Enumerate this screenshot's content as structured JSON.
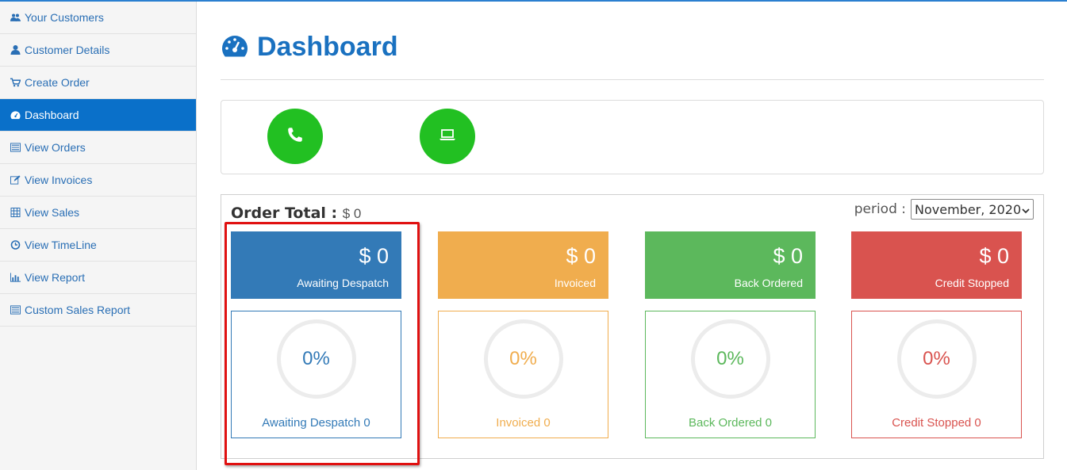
{
  "sidebar": {
    "items": [
      {
        "label": "Your Customers",
        "icon": "users-icon"
      },
      {
        "label": "Customer Details",
        "icon": "user-icon"
      },
      {
        "label": "Create Order",
        "icon": "cart-icon"
      },
      {
        "label": "Dashboard",
        "icon": "dashboard-icon",
        "active": true
      },
      {
        "label": "View Orders",
        "icon": "list-icon"
      },
      {
        "label": "View Invoices",
        "icon": "edit-icon"
      },
      {
        "label": "View Sales",
        "icon": "calculator-icon"
      },
      {
        "label": "View TimeLine",
        "icon": "clock-icon"
      },
      {
        "label": "View Report",
        "icon": "bar-chart-icon"
      },
      {
        "label": "Custom Sales Report",
        "icon": "list-icon"
      }
    ]
  },
  "header": {
    "title": "Dashboard",
    "icon": "dashboard-icon"
  },
  "contact": {
    "buttons": [
      {
        "icon": "phone-icon"
      },
      {
        "icon": "laptop-icon"
      }
    ]
  },
  "order": {
    "total_label": "Order Total :",
    "total_value": "$ 0",
    "period_label": "period :",
    "period_value": "November, 2020",
    "stats": [
      {
        "amount": "$ 0",
        "label": "Awaiting Despatch",
        "percent": "0%",
        "footer": "Awaiting Despatch 0",
        "color": "#337ab7"
      },
      {
        "amount": "$ 0",
        "label": "Invoiced",
        "percent": "0%",
        "footer": "Invoiced 0",
        "color": "#f0ad4e"
      },
      {
        "amount": "$ 0",
        "label": "Back Ordered",
        "percent": "0%",
        "footer": "Back Ordered 0",
        "color": "#5cb85c"
      },
      {
        "amount": "$ 0",
        "label": "Credit Stopped",
        "percent": "0%",
        "footer": "Credit Stopped 0",
        "color": "#d9534f"
      }
    ]
  },
  "colors": {
    "accent": "#0a70c9",
    "link": "#2a6fb5",
    "title": "#1a71c0",
    "contact_green": "#22c022",
    "highlight": "#e01010"
  }
}
